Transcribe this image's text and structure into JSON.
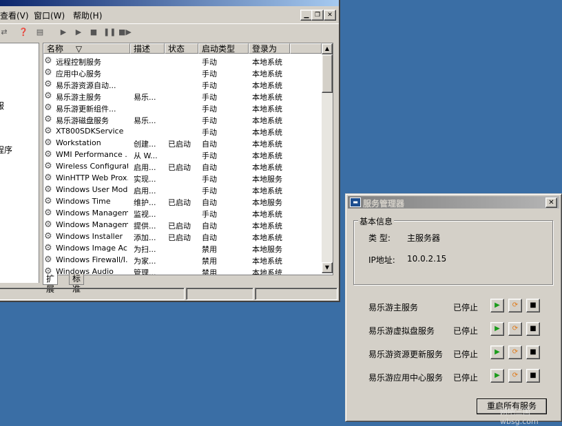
{
  "services_window": {
    "menu": [
      "查看(V)",
      "窗口(W)",
      "帮助(H)"
    ],
    "left_pane_items": [
      "服",
      "程序"
    ],
    "columns": [
      "名称",
      "描述",
      "状态",
      "启动类型",
      "登录为"
    ],
    "rows": [
      {
        "name": "远程控制服务",
        "desc": "",
        "status": "",
        "startup": "手动",
        "logon": "本地系统"
      },
      {
        "name": "应用中心服务",
        "desc": "",
        "status": "",
        "startup": "手动",
        "logon": "本地系统"
      },
      {
        "name": "易乐游资源自动...",
        "desc": "",
        "status": "",
        "startup": "手动",
        "logon": "本地系统"
      },
      {
        "name": "易乐游主服务",
        "desc": "易乐...",
        "status": "",
        "startup": "手动",
        "logon": "本地系统"
      },
      {
        "name": "易乐游更新组件...",
        "desc": "",
        "status": "",
        "startup": "手动",
        "logon": "本地系统"
      },
      {
        "name": "易乐游磁盘服务",
        "desc": "易乐...",
        "status": "",
        "startup": "手动",
        "logon": "本地系统"
      },
      {
        "name": "XT800SDKService",
        "desc": "",
        "status": "",
        "startup": "手动",
        "logon": "本地系统"
      },
      {
        "name": "Workstation",
        "desc": "创建...",
        "status": "已启动",
        "startup": "自动",
        "logon": "本地系统"
      },
      {
        "name": "WMI Performance ...",
        "desc": "从 W...",
        "status": "",
        "startup": "手动",
        "logon": "本地系统"
      },
      {
        "name": "Wireless Configurat...",
        "desc": "启用...",
        "status": "已启动",
        "startup": "自动",
        "logon": "本地系统"
      },
      {
        "name": "WinHTTP Web Prox...",
        "desc": "实现...",
        "status": "",
        "startup": "手动",
        "logon": "本地服务"
      },
      {
        "name": "Windows User Mod...",
        "desc": "启用...",
        "status": "",
        "startup": "手动",
        "logon": "本地系统"
      },
      {
        "name": "Windows Time",
        "desc": "维护...",
        "status": "已启动",
        "startup": "自动",
        "logon": "本地服务"
      },
      {
        "name": "Windows Managem...",
        "desc": "监视...",
        "status": "",
        "startup": "手动",
        "logon": "本地系统"
      },
      {
        "name": "Windows Managem...",
        "desc": "提供...",
        "status": "已启动",
        "startup": "自动",
        "logon": "本地系统"
      },
      {
        "name": "Windows Installer",
        "desc": "添加...",
        "status": "已启动",
        "startup": "自动",
        "logon": "本地系统"
      },
      {
        "name": "Windows Image Ac...",
        "desc": "为扫...",
        "status": "",
        "startup": "禁用",
        "logon": "本地服务"
      },
      {
        "name": "Windows Firewall/I...",
        "desc": "为家...",
        "status": "",
        "startup": "禁用",
        "logon": "本地系统"
      },
      {
        "name": "Windows Audio",
        "desc": "管理...",
        "status": "",
        "startup": "禁用",
        "logon": "本地系统"
      }
    ],
    "tabs": [
      "扩展",
      "标准"
    ]
  },
  "manager": {
    "title": "服务管理器",
    "group_label": "基本信息",
    "type_label": "类 型:",
    "type_value": "主服务器",
    "ip_label": "IP地址:",
    "ip_value": "10.0.2.15",
    "services": [
      {
        "name": "易乐游主服务",
        "status": "已停止"
      },
      {
        "name": "易乐游虚拟盘服务",
        "status": "已停止"
      },
      {
        "name": "易乐游资源更新服务",
        "status": "已停止"
      },
      {
        "name": "易乐游应用中心服务",
        "status": "已停止"
      }
    ],
    "restart_all_label": "重启所有服务"
  },
  "watermark": "网吧三国 wbsg.com",
  "colors": {
    "desktop": "#3a6ea5",
    "window_face": "#d4d0c8",
    "title_active_start": "#0a246a",
    "title_inactive": "#808080",
    "start_green": "#1a9b1a",
    "restart_orange": "#e07b1a"
  }
}
